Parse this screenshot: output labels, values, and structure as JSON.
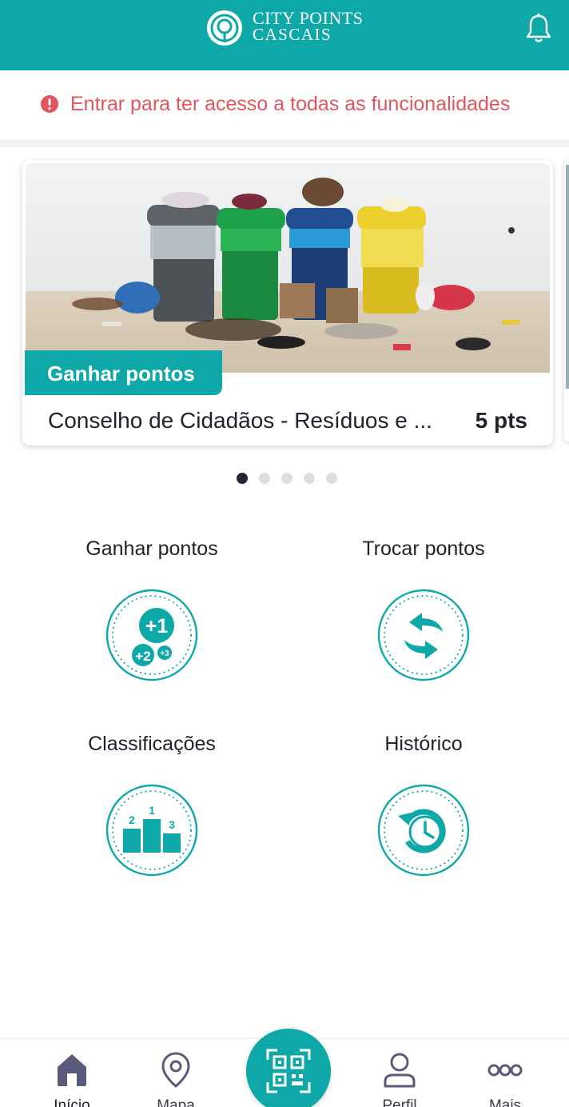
{
  "app": {
    "brand_line1": "CITY POINTS",
    "brand_line2": "CASCAIS",
    "brand_color": "#0fa8a8",
    "logo_icon": "location-pin-icon",
    "notifications_icon": "bell-icon"
  },
  "banner": {
    "icon": "alert-circle-icon",
    "text": "Entrar para ter acesso a todas as funcionalidades",
    "color": "#e2555f"
  },
  "carousel": {
    "active_index": 0,
    "page_count": 5,
    "cards": [
      {
        "tag": "Ganhar pontos",
        "title": "Conselho de Cidadãos - Resíduos e ...",
        "points": "5 pts",
        "image": "recycling-bins-photo"
      }
    ]
  },
  "features": [
    {
      "label": "Ganhar pontos",
      "icon": "earn-points-icon"
    },
    {
      "label": "Trocar pontos",
      "icon": "exchange-points-icon"
    },
    {
      "label": "Classificações",
      "icon": "podium-icon"
    },
    {
      "label": "Histórico",
      "icon": "history-icon"
    }
  ],
  "bottom_nav": {
    "items": [
      {
        "label": "Início",
        "icon": "home-icon",
        "active": true
      },
      {
        "label": "Mapa",
        "icon": "map-pin-icon",
        "active": false
      },
      {
        "label": "",
        "icon": "qr-code-icon",
        "active": false
      },
      {
        "label": "Perfil",
        "icon": "user-icon",
        "active": false
      },
      {
        "label": "Mais",
        "icon": "more-icon",
        "active": false
      }
    ]
  }
}
